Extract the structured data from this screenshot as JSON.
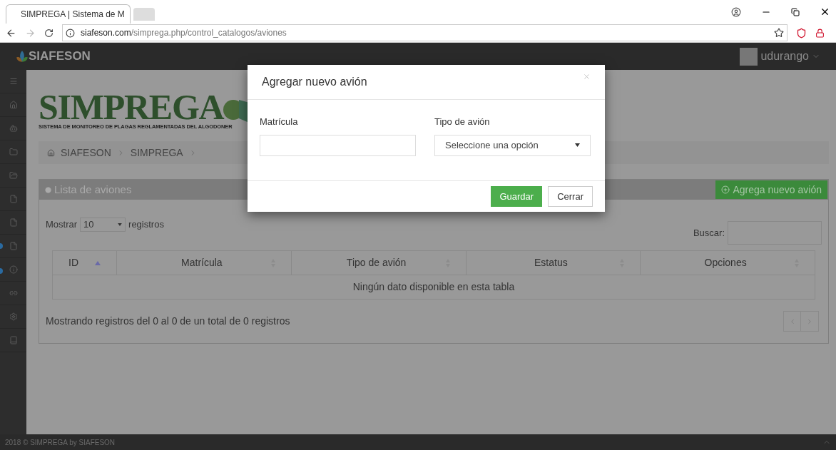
{
  "browser": {
    "tab_title": "SIMPREGA | Sistema de M",
    "url_domain": "siafeson.com",
    "url_path": "/simprega.php/control_catalogos/aviones"
  },
  "header": {
    "brand": "SIAFESON",
    "user": "udurango"
  },
  "logo": {
    "title": "SIMPREGA",
    "subtitle": "SISTEMA DE MONITOREO DE PLAGAS REGLAMENTADAS DEL ALGODONER"
  },
  "breadcrumb": [
    "SIAFESON",
    "SIMPREGA"
  ],
  "panel": {
    "title": "Lista de aviones",
    "add_button": "Agrega nuevo avión",
    "show_label": "Mostrar",
    "show_value": "10",
    "show_suffix": "registros",
    "search_label": "Buscar:",
    "columns": [
      {
        "label": "ID",
        "sorted_ascending": true
      },
      {
        "label": "Matrícula",
        "sorted_ascending": false
      },
      {
        "label": "Tipo de avión",
        "sorted_ascending": false
      },
      {
        "label": "Estatus",
        "sorted_ascending": false
      },
      {
        "label": "Opciones",
        "sorted_ascending": false
      }
    ],
    "empty": "Ningún dato disponible en esta tabla",
    "info": "Mostrando registros del 0 al 0 de un total de 0 registros"
  },
  "footer": "2018 © SIMPREGA by SIAFESON",
  "modal": {
    "title": "Agregar nuevo avión",
    "fields": [
      {
        "kind": "text",
        "label": "Matrícula"
      },
      {
        "kind": "select",
        "label": "Tipo de avión",
        "value": "Seleccione una opción"
      }
    ],
    "buttons": [
      {
        "label": "Guardar",
        "kind": "primary"
      },
      {
        "label": "Cerrar",
        "kind": "default"
      }
    ]
  }
}
